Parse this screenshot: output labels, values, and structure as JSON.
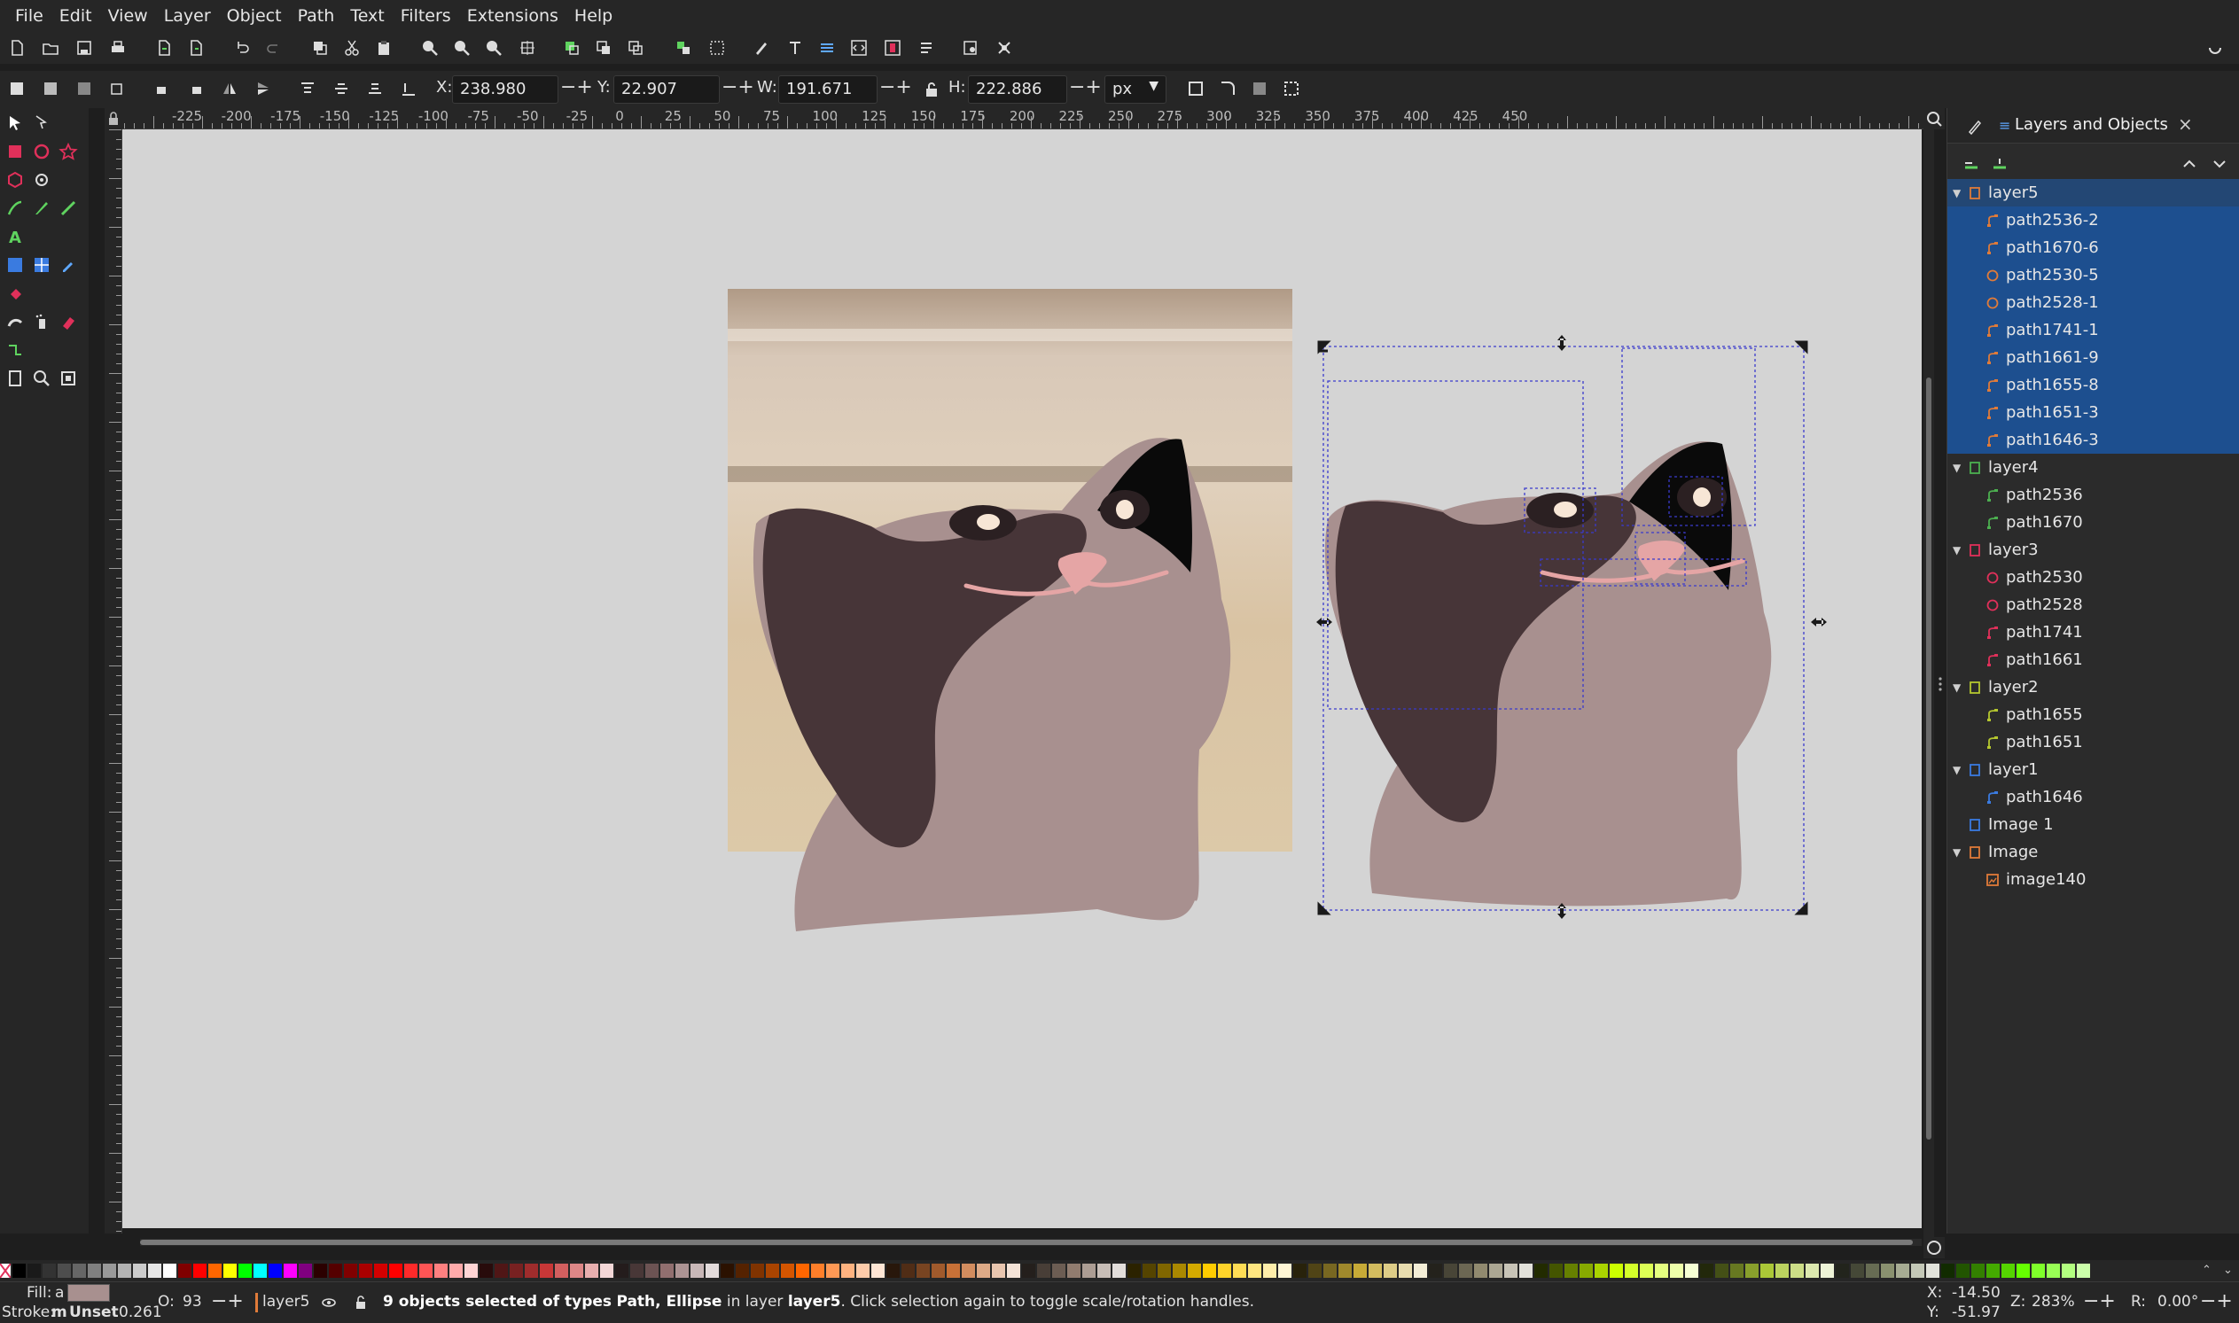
{
  "menu": [
    "File",
    "Edit",
    "View",
    "Layer",
    "Object",
    "Path",
    "Text",
    "Filters",
    "Extensions",
    "Help"
  ],
  "controls": {
    "x_label": "X:",
    "x_value": "238.980",
    "y_label": "Y:",
    "y_value": "22.907",
    "w_label": "W:",
    "w_value": "191.671",
    "h_label": "H:",
    "h_value": "222.886",
    "unit": "px"
  },
  "ruler_labels": [
    "-225",
    "-200",
    "-175",
    "-150",
    "-125",
    "-100",
    "-75",
    "-50",
    "-25",
    "0",
    "25",
    "50",
    "75",
    "100",
    "125",
    "150",
    "175",
    "200",
    "225",
    "250",
    "275",
    "300",
    "325",
    "350",
    "375",
    "400",
    "425",
    "450"
  ],
  "dock": {
    "tab_label": "Layers and Objects",
    "close": "×",
    "tree": [
      {
        "label": "layer5",
        "type": "layer",
        "level": 0,
        "expanded": true,
        "selected": true,
        "color": "#e07b39"
      },
      {
        "label": "path2536-2",
        "type": "path",
        "level": 1,
        "selected": true,
        "color": "#e07b39"
      },
      {
        "label": "path1670-6",
        "type": "path",
        "level": 1,
        "selected": true,
        "color": "#e07b39"
      },
      {
        "label": "path2530-5",
        "type": "ellipse",
        "level": 1,
        "selected": true,
        "color": "#e07b39"
      },
      {
        "label": "path2528-1",
        "type": "ellipse",
        "level": 1,
        "selected": true,
        "color": "#e07b39"
      },
      {
        "label": "path1741-1",
        "type": "path",
        "level": 1,
        "selected": true,
        "color": "#e07b39"
      },
      {
        "label": "path1661-9",
        "type": "path",
        "level": 1,
        "selected": true,
        "color": "#e07b39"
      },
      {
        "label": "path1655-8",
        "type": "path",
        "level": 1,
        "selected": true,
        "color": "#e07b39"
      },
      {
        "label": "path1651-3",
        "type": "path",
        "level": 1,
        "selected": true,
        "color": "#e07b39"
      },
      {
        "label": "path1646-3",
        "type": "path",
        "level": 1,
        "selected": true,
        "color": "#e07b39"
      },
      {
        "label": "layer4",
        "type": "layer",
        "level": 0,
        "expanded": true,
        "selected": false,
        "color": "#4caf50"
      },
      {
        "label": "path2536",
        "type": "path",
        "level": 1,
        "selected": false,
        "color": "#4caf50"
      },
      {
        "label": "path1670",
        "type": "path",
        "level": 1,
        "selected": false,
        "color": "#4caf50"
      },
      {
        "label": "layer3",
        "type": "layer",
        "level": 0,
        "expanded": true,
        "selected": false,
        "color": "#e0305a"
      },
      {
        "label": "path2530",
        "type": "ellipse",
        "level": 1,
        "selected": false,
        "color": "#e0305a"
      },
      {
        "label": "path2528",
        "type": "ellipse",
        "level": 1,
        "selected": false,
        "color": "#e0305a"
      },
      {
        "label": "path1741",
        "type": "path",
        "level": 1,
        "selected": false,
        "color": "#e0305a"
      },
      {
        "label": "path1661",
        "type": "path",
        "level": 1,
        "selected": false,
        "color": "#e0305a"
      },
      {
        "label": "layer2",
        "type": "layer",
        "level": 0,
        "expanded": true,
        "selected": false,
        "color": "#b5c72f"
      },
      {
        "label": "path1655",
        "type": "path",
        "level": 1,
        "selected": false,
        "color": "#b5c72f"
      },
      {
        "label": "path1651",
        "type": "path",
        "level": 1,
        "selected": false,
        "color": "#b5c72f"
      },
      {
        "label": "layer1",
        "type": "layer",
        "level": 0,
        "expanded": true,
        "selected": false,
        "color": "#3a7be0"
      },
      {
        "label": "path1646",
        "type": "path",
        "level": 1,
        "selected": false,
        "color": "#3a7be0"
      },
      {
        "label": "Image 1",
        "type": "layer",
        "level": 0,
        "expanded": false,
        "selected": false,
        "color": "#3a7be0"
      },
      {
        "label": "Image",
        "type": "layer",
        "level": 0,
        "expanded": true,
        "selected": false,
        "color": "#e07b39"
      },
      {
        "label": "image140",
        "type": "image",
        "level": 1,
        "selected": false,
        "color": "#e07b39"
      }
    ]
  },
  "status": {
    "fill_label": "Fill:",
    "fill_value": "a",
    "fill_color": "#a8908f",
    "stroke_label": "Stroke:",
    "stroke_value": "m",
    "stroke_unset": "Unset",
    "stroke_width": "0.261",
    "opacity_label": "O:",
    "opacity_value": "93",
    "layer_name": "layer5",
    "message_count": "9 objects selected of types",
    "message_types": "Path, Ellipse",
    "message_in_layer": "in layer",
    "message_layer": "layer5",
    "message_tail": ". Click selection again to toggle scale/rotation handles.",
    "x_label": "X:",
    "x_value": "-14.50",
    "y_label": "Y:",
    "y_value": "-51.97",
    "zoom_label": "Z:",
    "zoom_value": "283%",
    "rot_label": "R:",
    "rot_value": "0.00°"
  },
  "colors": {
    "cat_body": "#a8908f",
    "cat_ear_dark": "#473538",
    "cat_ear_black": "#0a0a0a",
    "cat_nose": "#e5a5a5",
    "selection_blue": "#1d4f8f"
  }
}
